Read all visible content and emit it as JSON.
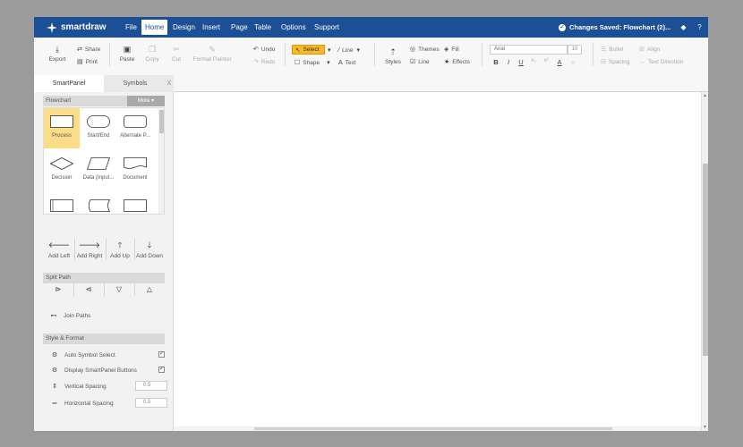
{
  "brand": {
    "name": "smartdraw"
  },
  "menu": [
    "File",
    "Home",
    "Design",
    "Insert",
    "Page",
    "Table",
    "Options",
    "Support"
  ],
  "active_menu": "Home",
  "status": {
    "saved_text": "Changes Saved: Flowchart (2)..."
  },
  "ribbon": {
    "export": "Export",
    "share": "Share",
    "print": "Print",
    "paste": "Paste",
    "copy": "Copy",
    "cut": "Cut",
    "format_painter": "Format Painter",
    "undo": "Undo",
    "redo": "Redo",
    "select": "Select",
    "line": "Line",
    "shape": "Shape",
    "text": "Text",
    "styles": "Styles",
    "themes": "Themes",
    "fill": "Fill",
    "line_style": "Line",
    "effects": "Effects",
    "font_name": "Arial",
    "font_size": "10",
    "bold": "B",
    "italic": "I",
    "underline": "U",
    "subscript": "x₂",
    "superscript": "x²",
    "font_color": "A",
    "bullet": "Bullet",
    "align": "Align",
    "spacing": "Spacing",
    "text_direction": "Text Direction"
  },
  "panel": {
    "tabs": [
      "SmartPanel",
      "Symbols"
    ],
    "close": "X",
    "flowchart_header": "Flowchart",
    "more_label": "More ▾",
    "shapes": [
      {
        "label": "Process",
        "shape": "rect"
      },
      {
        "label": "Start/End",
        "shape": "terminator"
      },
      {
        "label": "Alternate P...",
        "shape": "roundrect"
      },
      {
        "label": "Decision",
        "shape": "diamond"
      },
      {
        "label": "Data (Input...",
        "shape": "parallelogram"
      },
      {
        "label": "Document",
        "shape": "document"
      },
      {
        "label": "",
        "shape": "rect2"
      },
      {
        "label": "",
        "shape": "stored"
      },
      {
        "label": "",
        "shape": "rect"
      }
    ],
    "arrows": [
      {
        "label": "Add Left",
        "icon": "arrow-left"
      },
      {
        "label": "Add Right",
        "icon": "arrow-right"
      },
      {
        "label": "Add Up",
        "icon": "arrow-up"
      },
      {
        "label": "Add Down",
        "icon": "arrow-down"
      }
    ],
    "split_header": "Split Path",
    "join_paths": "Join Paths",
    "style_header": "Style & Format",
    "options": [
      {
        "label": "Auto Symbol Select",
        "checked": true
      },
      {
        "label": "Display SmartPanel Buttons",
        "checked": true
      }
    ],
    "vertical_spacing_label": "Vertical Spacing",
    "vertical_spacing_value": "0.5",
    "horizontal_spacing_label": "Horizontal Spacing",
    "horizontal_spacing_value": "0.5"
  },
  "colors": {
    "topbar": "#1b4f96",
    "select": "#f7b925",
    "selected_shape": "#fbdc87"
  }
}
